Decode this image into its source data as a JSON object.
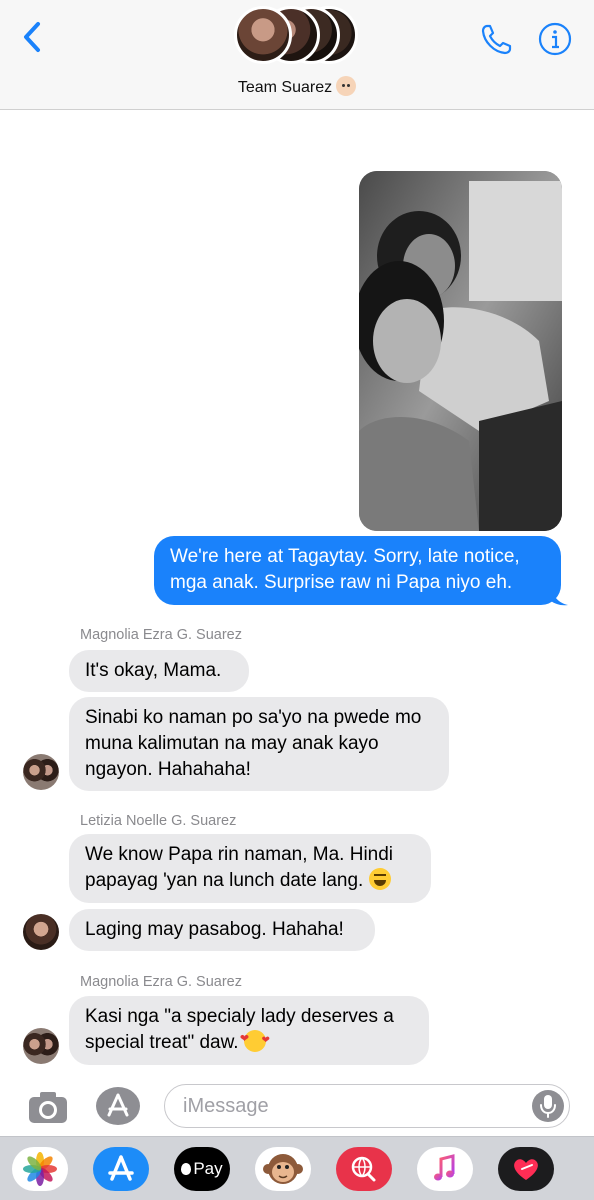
{
  "header": {
    "title": "Team Suarez",
    "title_emoji": "baby-face-icon"
  },
  "messages": [
    {
      "type": "photo",
      "direction": "outgoing",
      "description_icon": "photo-attachment"
    },
    {
      "direction": "outgoing",
      "text": "We're here at Tagaytay. Sorry, late notice, mga anak. Surprise raw ni Papa niyo eh."
    },
    {
      "direction": "incoming",
      "sender": "Magnolia Ezra G. Suarez",
      "text": "It's okay, Mama."
    },
    {
      "direction": "incoming",
      "text": "Sinabi ko naman po sa'yo na pwede mo muna kalimutan na may anak kayo ngayon. Hahahaha!"
    },
    {
      "direction": "incoming",
      "sender": "Letizia Noelle G. Suarez",
      "text": "We know Papa rin naman, Ma. Hindi papayag 'yan na lunch date lang."
    },
    {
      "direction": "incoming",
      "text": "Laging may pasabog. Hahaha!"
    },
    {
      "direction": "incoming",
      "sender": "Magnolia Ezra G. Suarez",
      "text": "Kasi nga \"a specialy lady deserves a special treat\" daw."
    }
  ],
  "input": {
    "placeholder": "iMessage",
    "value": ""
  },
  "app_drawer": {
    "apple_pay_label": "Pay",
    "items": [
      "photos",
      "app-store",
      "apple-pay",
      "animoji",
      "web-search",
      "music",
      "digital-touch"
    ]
  },
  "colors": {
    "accent": "#1a82fb",
    "incoming_bubble": "#e9e9eb",
    "sender_name": "#8a8a8e"
  }
}
